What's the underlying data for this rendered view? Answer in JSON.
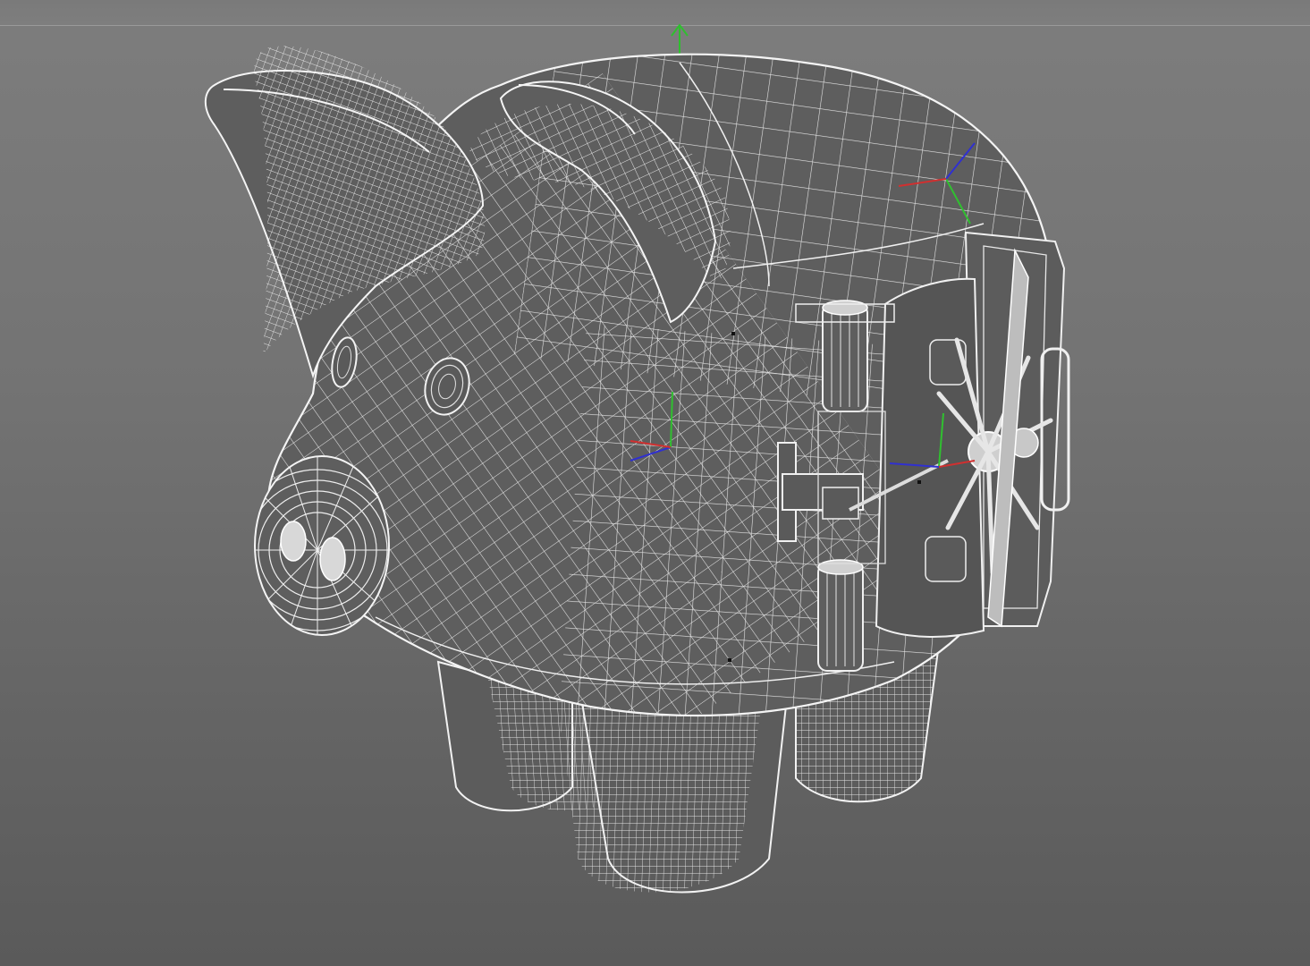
{
  "viewport": {
    "background_top": "#7d7d7d",
    "background_bottom": "#5a5a5a",
    "wire_color": "#e8e8e8",
    "surface_color": "#5c5c5c",
    "axis_colors": {
      "x": "#d03030",
      "y": "#30c030",
      "z": "#3030d0"
    }
  },
  "model": {
    "shading": "wireframe"
  },
  "icons": [
    "world-y-axis-icon",
    "object-axis-gizmo-icon"
  ]
}
